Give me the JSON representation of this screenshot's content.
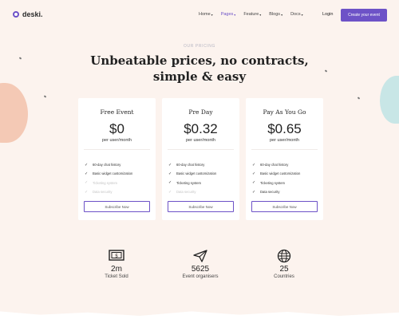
{
  "brand": {
    "name": "deski."
  },
  "nav": {
    "items": [
      {
        "label": "Home",
        "active": false
      },
      {
        "label": "Pages",
        "active": true
      },
      {
        "label": "Feature",
        "active": false
      },
      {
        "label": "Blogs",
        "active": false
      },
      {
        "label": "Docs",
        "active": false
      }
    ],
    "login_label": "Login",
    "cta_label": "Create your event"
  },
  "hero": {
    "eyebrow": "OUR PRICING",
    "title_line1": "Unbeatable prices, no contracts,",
    "title_line2": "simple & easy"
  },
  "plans": [
    {
      "name": "Free Event",
      "price": "$0",
      "unit": "per user/month",
      "features": [
        {
          "label": "60-day chat history",
          "included": true
        },
        {
          "label": "Basic widget customization",
          "included": true
        },
        {
          "label": "Ticketing system",
          "included": false
        },
        {
          "label": "Data security",
          "included": false
        }
      ],
      "button": "Subscribe Now"
    },
    {
      "name": "Pre Day",
      "price": "$0.32",
      "unit": "per user/month",
      "features": [
        {
          "label": "60-day chat history",
          "included": true
        },
        {
          "label": "Basic widget customization",
          "included": true
        },
        {
          "label": "Ticketing system",
          "included": true
        },
        {
          "label": "Data security",
          "included": false
        }
      ],
      "button": "Subscribe Now"
    },
    {
      "name": "Pay As You Go",
      "price": "$0.65",
      "unit": "per user/month",
      "features": [
        {
          "label": "60-day chat history",
          "included": true
        },
        {
          "label": "Basic widget customization",
          "included": true
        },
        {
          "label": "Ticketing system",
          "included": true
        },
        {
          "label": "Data security",
          "included": true
        }
      ],
      "button": "Subscribe Now"
    }
  ],
  "stats": [
    {
      "icon": "ticket-icon",
      "value": "2m",
      "label": "Ticket Sold"
    },
    {
      "icon": "paper-plane-icon",
      "value": "5625",
      "label": "Event organisers"
    },
    {
      "icon": "globe-icon",
      "value": "25",
      "label": "Countries"
    }
  ],
  "colors": {
    "accent": "#6d52c7",
    "background": "#fcf3ee",
    "blob_peach": "#f4c9b5",
    "blob_mint": "#c8e6e6"
  }
}
